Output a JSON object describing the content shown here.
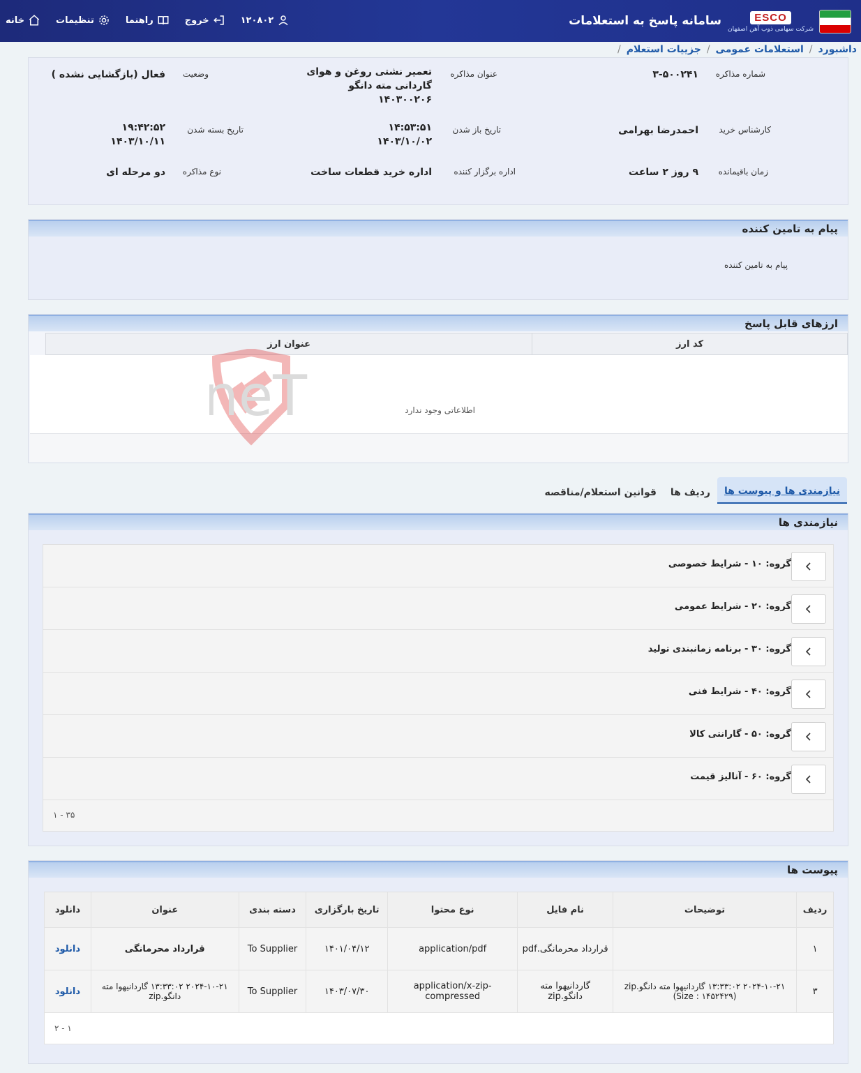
{
  "header": {
    "brand": "ESCO",
    "brand_sub": "شرکت سهامی ذوب آهن اصفهان",
    "title": "سامانه پاسخ به استعلامات",
    "nav": {
      "home": "خانه",
      "settings": "تنظیمات",
      "guide": "راهنما",
      "logout": "خروج",
      "user_id": "۱۲۰۸۰۲"
    }
  },
  "breadcrumb": {
    "items": [
      "داشبورد",
      "استعلامات عمومی",
      "جزییات استعلام"
    ],
    "sep": "/"
  },
  "details": {
    "negotiation_no_label": "شماره مذاکره",
    "negotiation_no": "۳-۵۰۰۲۴۱",
    "title_label": "عنوان مذاکره",
    "title_line1": "تعمیر نشتی روغن و هوای",
    "title_line2": "گاردانی مته دانگو",
    "title_line3": "۱۴۰۳۰۰۲۰۶",
    "status_label": "وضعیت",
    "status": "فعال (بازگشایی نشده )",
    "buyer_label": "کارشناس خرید",
    "buyer": "احمدرضا بهرامی",
    "open_date_label": "تاریخ باز شدن",
    "open_time": "۱۴:۵۳:۵۱",
    "open_date": "۱۴۰۳/۱۰/۰۲",
    "close_date_label": "تاریخ بسته شدن",
    "close_time": "۱۹:۴۲:۵۲",
    "close_date": "۱۴۰۳/۱۰/۱۱",
    "remaining_label": "زمان باقیمانده",
    "remaining": "۹ روز ۲ ساعت",
    "department_label": "اداره برگزار کننده",
    "department": "اداره خرید قطعات ساخت",
    "type_label": "نوع مذاکره",
    "type": "دو مرحله ای"
  },
  "message": {
    "heading": "پیام به تامین کننده",
    "text": "پیام به تامین کننده"
  },
  "currencies": {
    "heading": "ارزهای قابل پاسخ",
    "col_code": "کد ارز",
    "col_title": "عنوان ارز",
    "empty": "اطلاعاتی وجود ندارد"
  },
  "watermark": "AriaTender.neT",
  "tabs": [
    "نیازمندی ها و پیوست ها",
    "ردیف ها",
    "قوانین استعلام/مناقصه"
  ],
  "requirements": {
    "heading": "نیازمندی ها",
    "items": [
      "گروه: ۱۰ - شرایط خصوصی",
      "گروه: ۲۰ - شرایط عمومی",
      "گروه: ۳۰ - برنامه زمانبندی تولید",
      "گروه: ۴۰ - شرایط فنی",
      "گروه: ۵۰ - گارانتی کالا",
      "گروه: ۶۰ - آنالیز قیمت"
    ],
    "pager": "۱ - ۳۵"
  },
  "attachments": {
    "heading": "پیوست ها",
    "columns": [
      "ردیف",
      "توضیحات",
      "نام فایل",
      "نوع محتوا",
      "تاریخ بارگزاری",
      "دسته بندی",
      "عنوان",
      "دانلود"
    ],
    "rows": [
      {
        "row": "۱",
        "desc": "",
        "file": "قرارداد محرمانگی.pdf",
        "mime": "application/pdf",
        "date": "۱۴۰۱/۰۴/۱۲",
        "category": "To Supplier",
        "title": "قرارداد محرمانگی",
        "download": "دانلود"
      },
      {
        "row": "۳",
        "desc": "۲۰۲۴-۱۰-۲۱ ۱۳:۳۳:۰۲ گاردانیهوا مته دانگو.zip (Size : ۱۴۵۲۴۲۹)",
        "file": "گاردانیهوا مته دانگو.zip",
        "mime": "application/x-zip-compressed",
        "date": "۱۴۰۳/۰۷/۳۰",
        "category": "To Supplier",
        "title": "۲۰۲۴-۱۰-۲۱ ۱۳:۳۳:۰۲ گاردانیهوا مته دانگو.zip",
        "download": "دانلود"
      }
    ],
    "pager": "۱ - ۲"
  },
  "colors": {
    "topbar": "#1f2f8a",
    "link": "#1f5aa8",
    "card_head": "#b9cfee",
    "page_bg": "#eef3f6"
  }
}
